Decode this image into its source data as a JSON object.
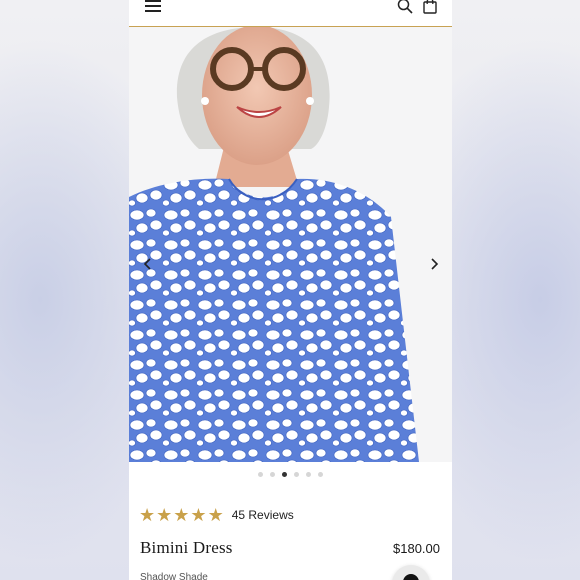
{
  "header": {
    "menu_icon": "hamburger-menu-icon",
    "search_icon": "search-icon",
    "bag_icon": "shopping-bag-icon",
    "accent_color": "#c8a253"
  },
  "gallery": {
    "image_description_icon": "product-photo",
    "prev_icon": "chevron-left-icon",
    "next_icon": "chevron-right-icon",
    "dot_count": 6,
    "active_dot": 3
  },
  "product": {
    "rating": 5,
    "reviews_label": "45 Reviews",
    "name": "Bimini Dress",
    "price": "$180.00",
    "variant_label": "Shadow Shade",
    "star_color": "#c9a14a"
  },
  "chat": {
    "icon": "chat-icon"
  }
}
